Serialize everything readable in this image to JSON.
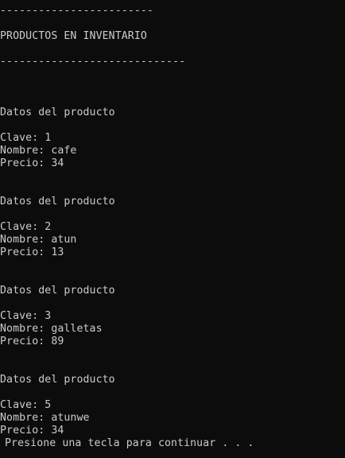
{
  "console": {
    "separator_top": "------------------------",
    "heading": "PRODUCTOS EN INVENTARIO",
    "separator_bottom": "-----------------------------",
    "products": [
      {
        "section_title": "Datos del producto",
        "clave": "Clave: 1",
        "nombre": "Nombre: cafe",
        "precio": "Precio: 34"
      },
      {
        "section_title": "Datos del producto",
        "clave": "Clave: 2",
        "nombre": "Nombre: atun",
        "precio": "Precio: 13"
      },
      {
        "section_title": "Datos del producto",
        "clave": "Clave: 3",
        "nombre": "Nombre: galletas",
        "precio": "Precio: 89"
      },
      {
        "section_title": "Datos del producto",
        "clave": "Clave: 5",
        "nombre": "Nombre: atunwe",
        "precio": "Precio: 34"
      }
    ],
    "prompt": "Presione una tecla para continuar . . ."
  },
  "colors": {
    "background": "#0c0c0c",
    "text": "#cccccc"
  }
}
